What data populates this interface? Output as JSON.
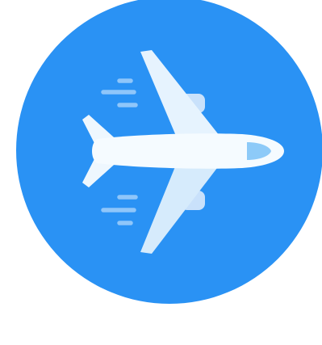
{
  "icon": {
    "name": "airplane-app-icon",
    "colors": {
      "background": "#ffffff",
      "circle": "#2a92f4",
      "fuselage": "#f5fbff",
      "wing_top": "#e6f3fe",
      "wing_bottom": "#d6ebfc",
      "engine": "#c9e1fb",
      "window": "#8dcaf8",
      "speed_lines": "#8fc6fa"
    }
  }
}
